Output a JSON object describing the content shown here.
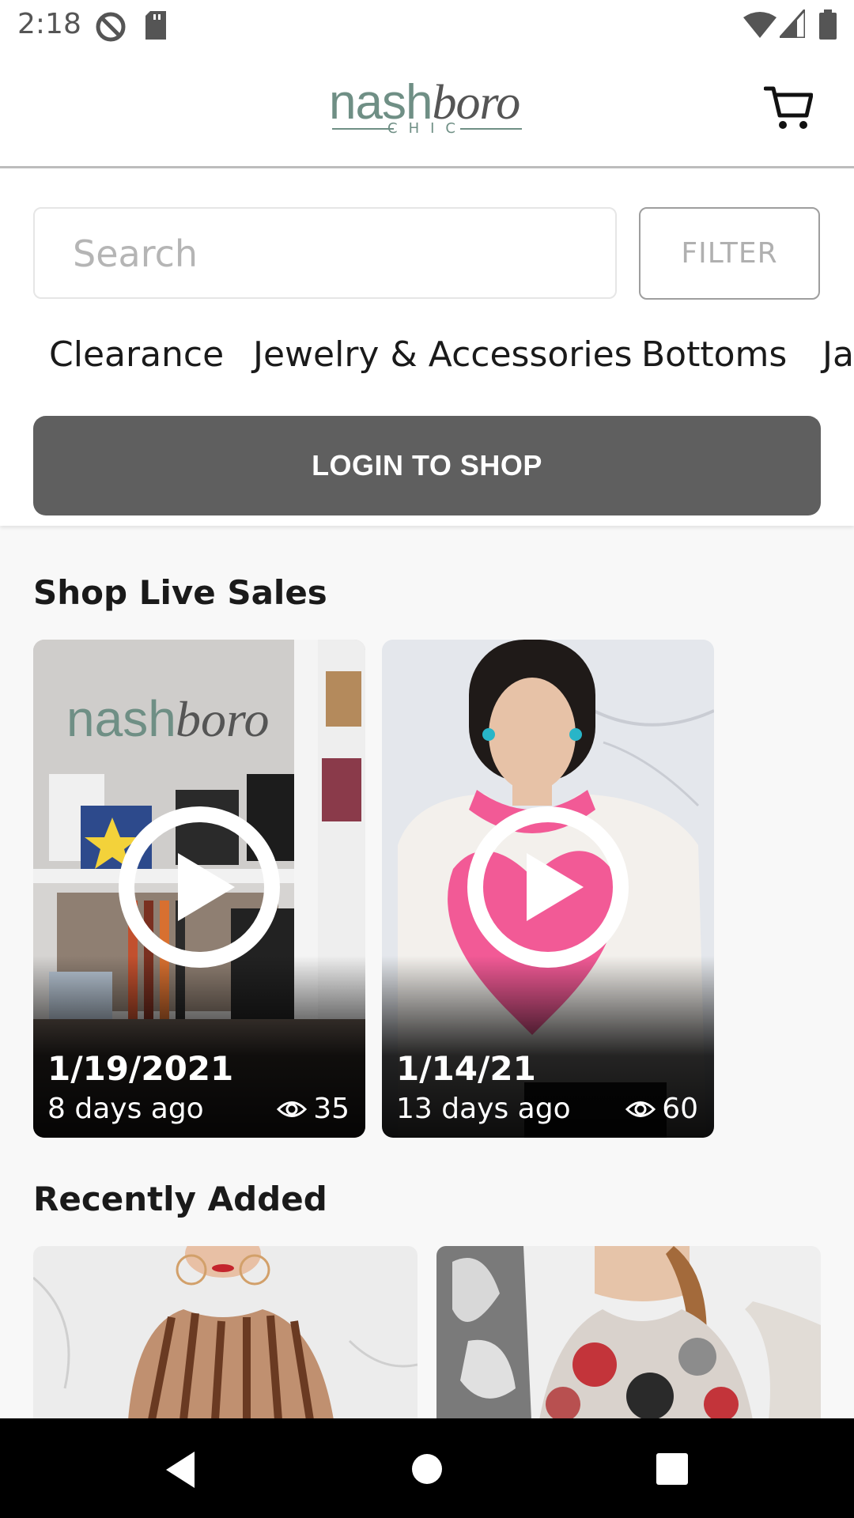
{
  "status_bar": {
    "time": "2:18",
    "icons": [
      "do-not-disturb-icon",
      "sd-card-icon",
      "wifi-icon",
      "cell-signal-icon",
      "battery-icon"
    ]
  },
  "header": {
    "logo_primary": "nash",
    "logo_secondary": "boro",
    "logo_sub": "CHIC",
    "cart_icon": "cart-icon"
  },
  "search": {
    "placeholder": "Search",
    "value": ""
  },
  "filter_label": "FILTER",
  "categories": [
    "Clearance",
    "Jewelry & Accessories",
    "Bottoms",
    "Ja"
  ],
  "login_button": "LOGIN TO SHOP",
  "live_sales": {
    "title": "Shop Live Sales",
    "cards": [
      {
        "date": "1/19/2021",
        "ago": "8 days ago",
        "views": "35"
      },
      {
        "date": "1/14/21",
        "ago": "13 days ago",
        "views": "60"
      }
    ]
  },
  "recently_added": {
    "title": "Recently Added"
  },
  "colors": {
    "accent_green": "#6f8f85",
    "login_bg": "#5f5f5f",
    "heart_pink": "#f25a96"
  }
}
